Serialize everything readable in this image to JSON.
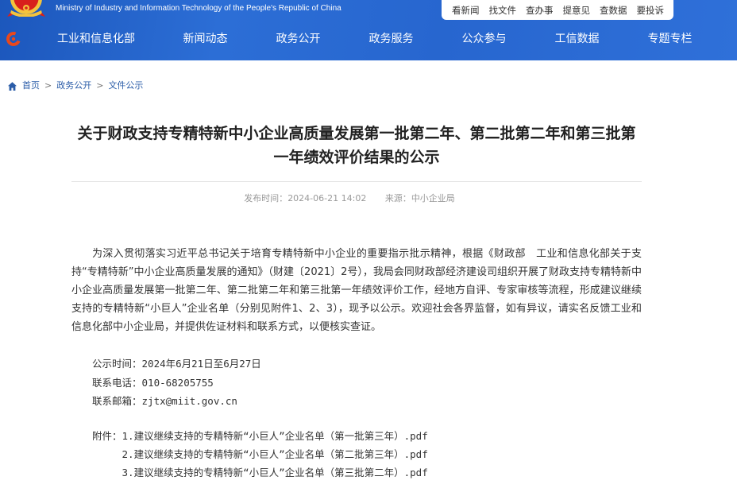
{
  "theme": {
    "header_blue": "#2766cf",
    "header_blue_dark": "#1c57bc",
    "link_blue": "#2a5ca8",
    "emblem_red": "#d8201c",
    "emblem_gold": "#f3c33d",
    "logo_orange": "#e8481c"
  },
  "icons": {
    "emblem": "national-emblem-icon",
    "logo": "ministry-logo-icon",
    "home": "home-icon"
  },
  "header": {
    "english_name": "Ministry of Industry and Information Technology of the People's Republic of China",
    "quick_links": [
      "看新闻",
      "找文件",
      "查办事",
      "提意见",
      "查数据",
      "要投诉"
    ],
    "nav": [
      "工业和信息化部",
      "新闻动态",
      "政务公开",
      "政务服务",
      "公众参与",
      "工信数据",
      "专题专栏"
    ]
  },
  "breadcrumb": {
    "items": [
      "首页",
      "政务公开",
      "文件公示"
    ],
    "separator": ">"
  },
  "article": {
    "title": "关于财政支持专精特新中小企业高质量发展第一批第二年、第二批第二年和第三批第一年绩效评价结果的公示",
    "meta": {
      "publish_label": "发布时间：",
      "publish_time": "2024-06-21 14:02",
      "source_label": "来源：",
      "source": "中小企业局"
    },
    "body": "为深入贯彻落实习近平总书记关于培育专精特新中小企业的重要指示批示精神，根据《财政部　工业和信息化部关于支持“专精特新”中小企业高质量发展的通知》（财建〔2021〕2号），我局会同财政部经济建设司组织开展了财政支持专精特新中小企业高质量发展第一批第二年、第二批第二年和第三批第一年绩效评价工作，经地方自评、专家审核等流程，形成建议继续支持的专精特新“小巨人”企业名单（分别见附件1、2、3），现予以公示。欢迎社会各界监督，如有异议，请实名反馈工业和信息化部中小企业局，并提供佐证材料和联系方式，以便核实查证。",
    "info": {
      "period_label": "公示时间：",
      "period": "2024年6月21日至6月27日",
      "phone_label": "联系电话：",
      "phone": "010-68205755",
      "email_label": "联系邮箱：",
      "email": "zjtx@miit.gov.cn"
    },
    "attachments_label": "附件：",
    "attachments": [
      "1.建议继续支持的专精特新“小巨人”企业名单（第一批第三年）.pdf",
      "2.建议继续支持的专精特新“小巨人”企业名单（第二批第三年）.pdf",
      "3.建议继续支持的专精特新“小巨人”企业名单（第三批第二年）.pdf"
    ]
  }
}
